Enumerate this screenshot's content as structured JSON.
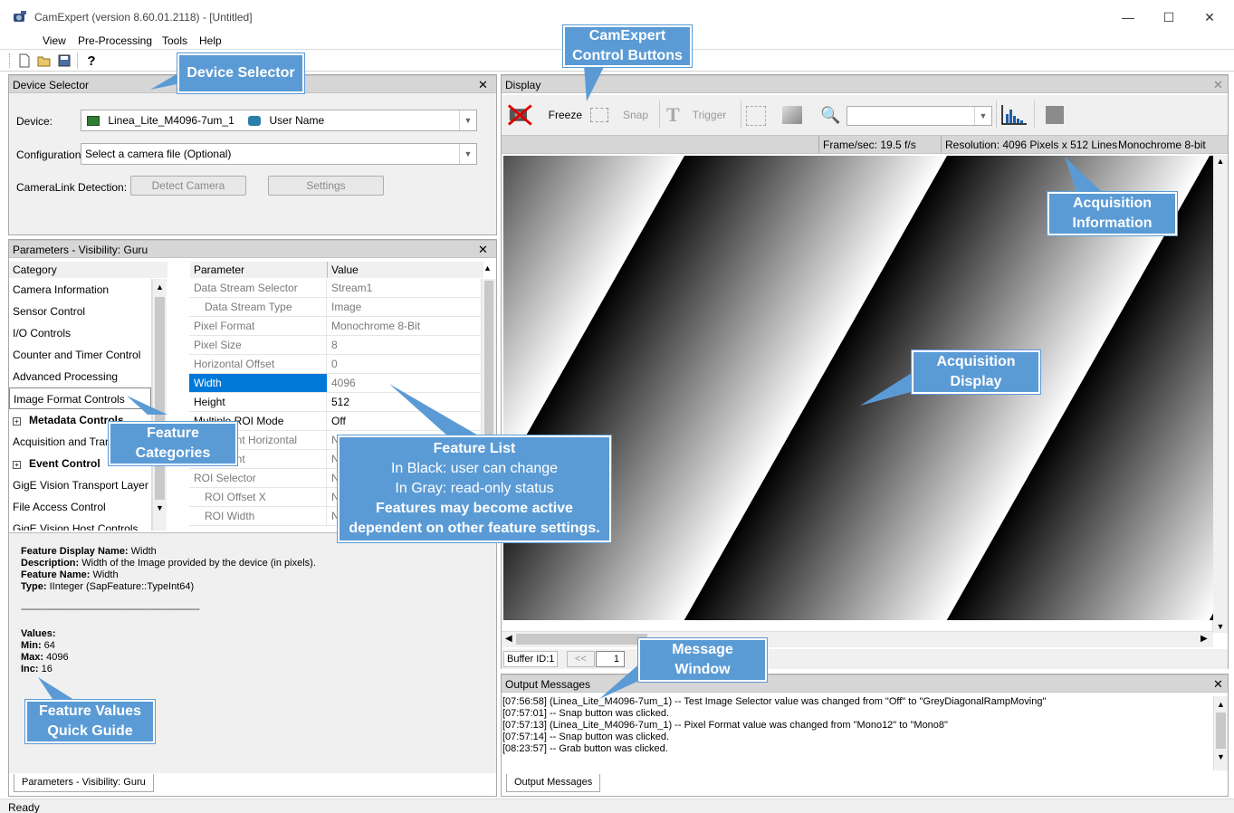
{
  "window": {
    "title": "CamExpert (version 8.60.01.2118) - [Untitled]",
    "minimize": "—",
    "maximize": "☐",
    "close": "✕"
  },
  "menu": {
    "items": [
      "View",
      "Pre-Processing",
      "Tools",
      "Help"
    ]
  },
  "device_selector": {
    "title": "Device Selector",
    "device_label": "Device:",
    "device_value": "Linea_Lite_M4096-7um_1",
    "user_name": "User Name",
    "configuration_label": "Configuration:",
    "configuration_value": "Select a camera file (Optional)",
    "detection_label": "CameraLink Detection:",
    "detect_button": "Detect Camera",
    "settings_button": "Settings"
  },
  "parameters": {
    "title": "Parameters - Visibility: Guru",
    "category_header": "Category",
    "parameter_header": "Parameter",
    "value_header": "Value",
    "categories": [
      "Camera Information",
      "Sensor Control",
      "I/O Controls",
      "Counter and Timer Control",
      "Advanced Processing",
      "Image Format Controls",
      "Metadata Controls",
      "Acquisition and Transfer Control",
      "Event Control",
      "GigE Vision Transport Layer",
      "File Access Control",
      "GigE Vision Host Controls"
    ],
    "rows": [
      {
        "name": "Data Stream Selector",
        "value": "Stream1"
      },
      {
        "name": "Data Stream Type",
        "value": "Image"
      },
      {
        "name": "Pixel Format",
        "value": "Monochrome 8-Bit"
      },
      {
        "name": "Pixel Size",
        "value": "8"
      },
      {
        "name": "Horizontal Offset",
        "value": "0"
      },
      {
        "name": "Width",
        "value": "4096"
      },
      {
        "name": "Height",
        "value": "512"
      },
      {
        "name": "Multiple ROI Mode",
        "value": "Off"
      },
      {
        "name": "ROI Count Horizontal",
        "value": "N"
      },
      {
        "name": "ROI Count",
        "value": "N"
      },
      {
        "name": "ROI Selector",
        "value": "N"
      },
      {
        "name": "ROI Offset X",
        "value": "N"
      },
      {
        "name": "ROI Width",
        "value": "N"
      }
    ],
    "tab_label": "Parameters - Visibility: Guru"
  },
  "feature_info": {
    "display_name_label": "Feature Display Name:",
    "display_name": "Width",
    "description_label": "Description:",
    "description": "Width of the Image provided by the device (in pixels).",
    "feature_name_label": "Feature Name:",
    "feature_name": "Width",
    "type_label": "Type:",
    "type": "IInteger (SapFeature::TypeInt64)",
    "separator": "--------------------------------------------------------------------------",
    "values_label": "Values:",
    "min_label": "Min:",
    "min": "64",
    "max_label": "Max:",
    "max": "4096",
    "inc_label": "Inc:",
    "inc": "16"
  },
  "display": {
    "title": "Display",
    "freeze": "Freeze",
    "snap": "Snap",
    "trigger": "Trigger",
    "frame_rate": "Frame/sec: 19.5 f/s",
    "resolution": "Resolution: 4096 Pixels x 512 Lines",
    "pixel_mode": "Monochrome 8-bit",
    "buffer_label": "Buffer ID:1",
    "buffer_prev": "<<",
    "buffer_value": "1"
  },
  "output": {
    "title": "Output Messages",
    "messages": [
      "[07:56:58] (Linea_Lite_M4096-7um_1)  -- Test Image Selector value was changed from \"Off\" to \"GreyDiagonalRampMoving\"",
      "[07:57:01] -- Snap button was clicked.",
      "[07:57:13] (Linea_Lite_M4096-7um_1)  -- Pixel Format value was changed from \"Mono12\" to \"Mono8\"",
      "[07:57:14] -- Snap button was clicked.",
      "[08:23:57] -- Grab button was clicked."
    ],
    "tab_label": "Output Messages"
  },
  "status": {
    "text": "Ready"
  },
  "callouts": {
    "device_selector": "Device Selector",
    "control_buttons_1": "CamExpert",
    "control_buttons_2": "Control Buttons",
    "acq_info_1": "Acquisition",
    "acq_info_2": "Information",
    "acq_display_1": "Acquisition",
    "acq_display_2": "Display",
    "feature_cat_1": "Feature",
    "feature_cat_2": "Categories",
    "feature_list_1": "Feature List",
    "feature_list_2": "In Black: user can change",
    "feature_list_3": "In Gray: read-only status",
    "feature_list_4": "Features may become active",
    "feature_list_5": "dependent on other feature settings.",
    "message_1": "Message",
    "message_2": "Window",
    "quick_guide_1": "Feature Values",
    "quick_guide_2": "Quick Guide"
  },
  "colors": {
    "callout": "#5b9bd5",
    "selected_row": "#0078d7",
    "panel_header": "#d6d6d6"
  }
}
